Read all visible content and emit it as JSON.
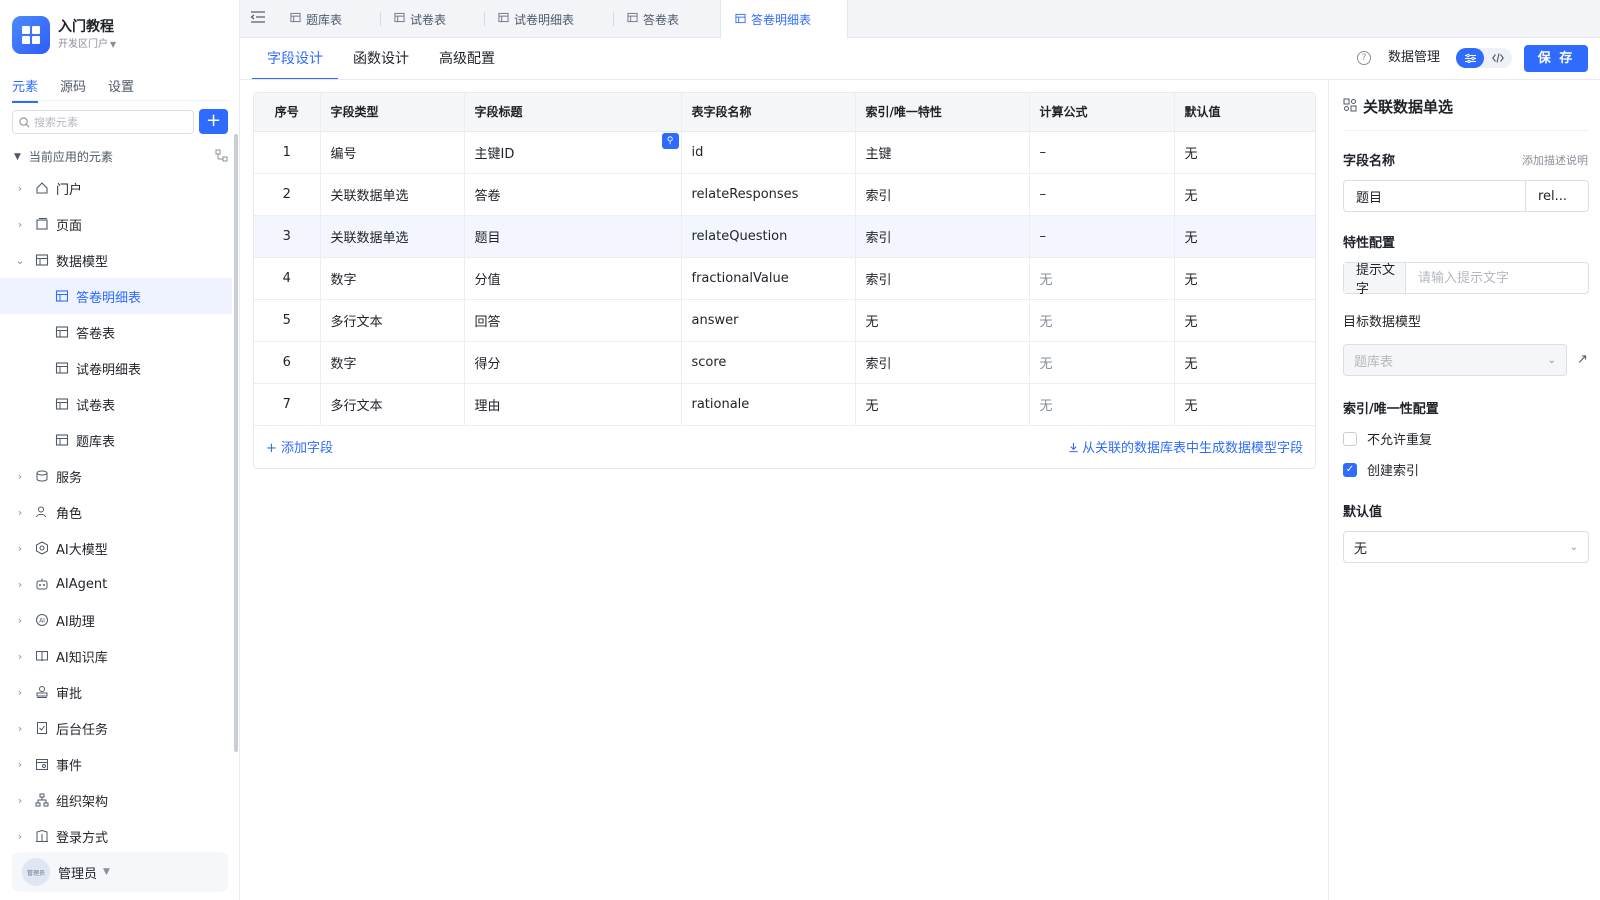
{
  "app": {
    "title": "入门教程",
    "subtitle": "开发区门户"
  },
  "sidebar": {
    "tabs": [
      "元素",
      "源码",
      "设置"
    ],
    "search_placeholder": "搜索元素",
    "section_title": "当前应用的元素",
    "items": [
      {
        "label": "门户",
        "icon": "home-icon"
      },
      {
        "label": "页面",
        "icon": "page-icon"
      },
      {
        "label": "数据模型",
        "icon": "table-icon"
      },
      {
        "label": "答卷明细表",
        "icon": "table-icon"
      },
      {
        "label": "答卷表",
        "icon": "table-icon"
      },
      {
        "label": "试卷明细表",
        "icon": "table-icon"
      },
      {
        "label": "试卷表",
        "icon": "table-icon"
      },
      {
        "label": "题库表",
        "icon": "table-icon"
      },
      {
        "label": "服务",
        "icon": "service-icon"
      },
      {
        "label": "角色",
        "icon": "role-icon"
      },
      {
        "label": "AI大模型",
        "icon": "ai-model-icon"
      },
      {
        "label": "AIAgent",
        "icon": "robot-icon"
      },
      {
        "label": "AI助理",
        "icon": "ai-assistant-icon"
      },
      {
        "label": "AI知识库",
        "icon": "book-icon"
      },
      {
        "label": "审批",
        "icon": "stamp-icon"
      },
      {
        "label": "后台任务",
        "icon": "task-icon"
      },
      {
        "label": "事件",
        "icon": "event-icon"
      },
      {
        "label": "组织架构",
        "icon": "org-icon"
      },
      {
        "label": "登录方式",
        "icon": "login-icon"
      }
    ],
    "user": {
      "name": "管理员",
      "avatar_text": "管理员"
    }
  },
  "top_tabs": [
    "题库表",
    "试卷表",
    "试卷明细表",
    "答卷表",
    "答卷明细表"
  ],
  "sub_tabs": [
    "字段设计",
    "函数设计",
    "高级配置"
  ],
  "toolbar": {
    "data_mgmt_label": "数据管理",
    "save_label": "保 存"
  },
  "table": {
    "headers": [
      "序号",
      "字段类型",
      "字段标题",
      "表字段名称",
      "索引/唯一特性",
      "计算公式",
      "默认值"
    ],
    "rows": [
      [
        "1",
        "编号",
        "主键ID",
        "id",
        "主键",
        "–",
        "无"
      ],
      [
        "2",
        "关联数据单选",
        "答卷",
        "relateResponses",
        "索引",
        "–",
        "无"
      ],
      [
        "3",
        "关联数据单选",
        "题目",
        "relateQuestion",
        "索引",
        "–",
        "无"
      ],
      [
        "4",
        "数字",
        "分值",
        "fractionalValue",
        "索引",
        "无",
        "无"
      ],
      [
        "5",
        "多行文本",
        "回答",
        "answer",
        "无",
        "无",
        "无"
      ],
      [
        "6",
        "数字",
        "得分",
        "score",
        "索引",
        "无",
        "无"
      ],
      [
        "7",
        "多行文本",
        "理由",
        "rationale",
        "无",
        "无",
        "无"
      ]
    ],
    "add_field_label": "+ 添加字段",
    "generate_label": "从关联的数据库表中生成数据模型字段"
  },
  "panel": {
    "title": "关联数据单选",
    "field_name_label": "字段名称",
    "add_desc_link": "添加描述说明",
    "field_title_value": "题目",
    "field_name_value": "rel...",
    "props_label": "特性配置",
    "hint_addon": "提示文字",
    "hint_placeholder": "请输入提示文字",
    "target_model_label": "目标数据模型",
    "target_model_value": "题库表",
    "index_label": "索引/唯一性配置",
    "no_dup_label": "不允许重复",
    "create_index_label": "创建索引",
    "default_label": "默认值",
    "default_value": "无"
  },
  "colors": {
    "accent": "#2f6bff",
    "selected_bg": "#eef3ff"
  }
}
